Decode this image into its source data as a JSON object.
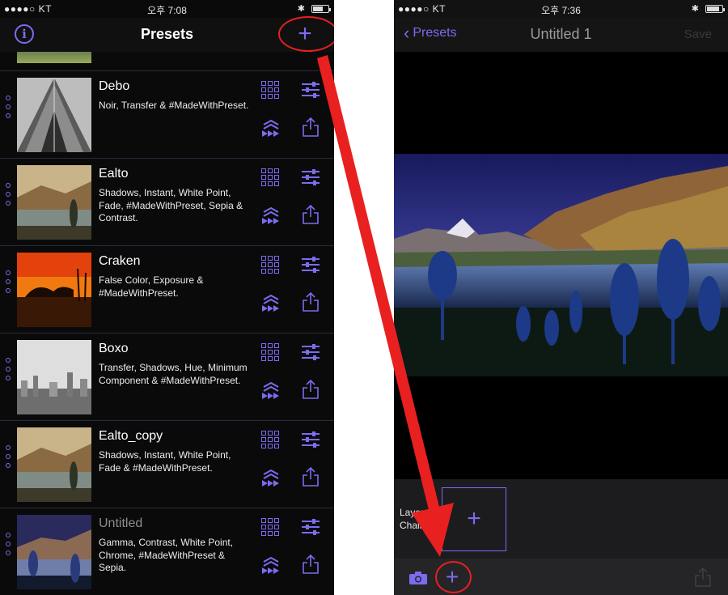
{
  "left_screen": {
    "status": {
      "carrier": "●●●●○ KT",
      "time": "오후 7:08"
    },
    "nav": {
      "title": "Presets",
      "info_glyph": "i",
      "add_glyph": "+"
    },
    "presets": [
      {
        "name": "Debo",
        "description": "Noir, Transfer & #MadeWithPreset.",
        "muted": false
      },
      {
        "name": "Ealto",
        "description": "Shadows, Instant, White Point, Fade, #MadeWithPreset, Sepia & Contrast.",
        "muted": false
      },
      {
        "name": "Craken",
        "description": "False Color, Exposure & #MadeWithPreset.",
        "muted": false
      },
      {
        "name": "Boxo",
        "description": "Transfer, Shadows, Hue, Minimum Component & #MadeWithPreset.",
        "muted": false
      },
      {
        "name": "Ealto_copy",
        "description": "Shadows, Instant, White Point, Fade & #MadeWithPreset.",
        "muted": false
      },
      {
        "name": "Untitled",
        "description": "Gamma, Contrast, White Point, Chrome, #MadeWithPreset & Sepia.",
        "muted": true
      }
    ]
  },
  "right_screen": {
    "status": {
      "carrier": "●●●●○ KT",
      "time": "오후 7:36"
    },
    "nav": {
      "back_label": "Presets",
      "back_glyph": "‹",
      "title": "Untitled 1",
      "save_label": "Save"
    },
    "layer_label": "Layer Chain",
    "layer_add_glyph": "+",
    "toolbar_add_glyph": "+"
  },
  "colors": {
    "accent": "#7b6cf0",
    "annotation": "#e82020",
    "background": "#0a0a0a"
  },
  "icons": [
    "info-icon",
    "plus-icon",
    "grid-icon",
    "sliders-icon",
    "transfer-icon",
    "share-icon",
    "chevron-left-icon",
    "camera-icon",
    "drag-dots-icon"
  ]
}
